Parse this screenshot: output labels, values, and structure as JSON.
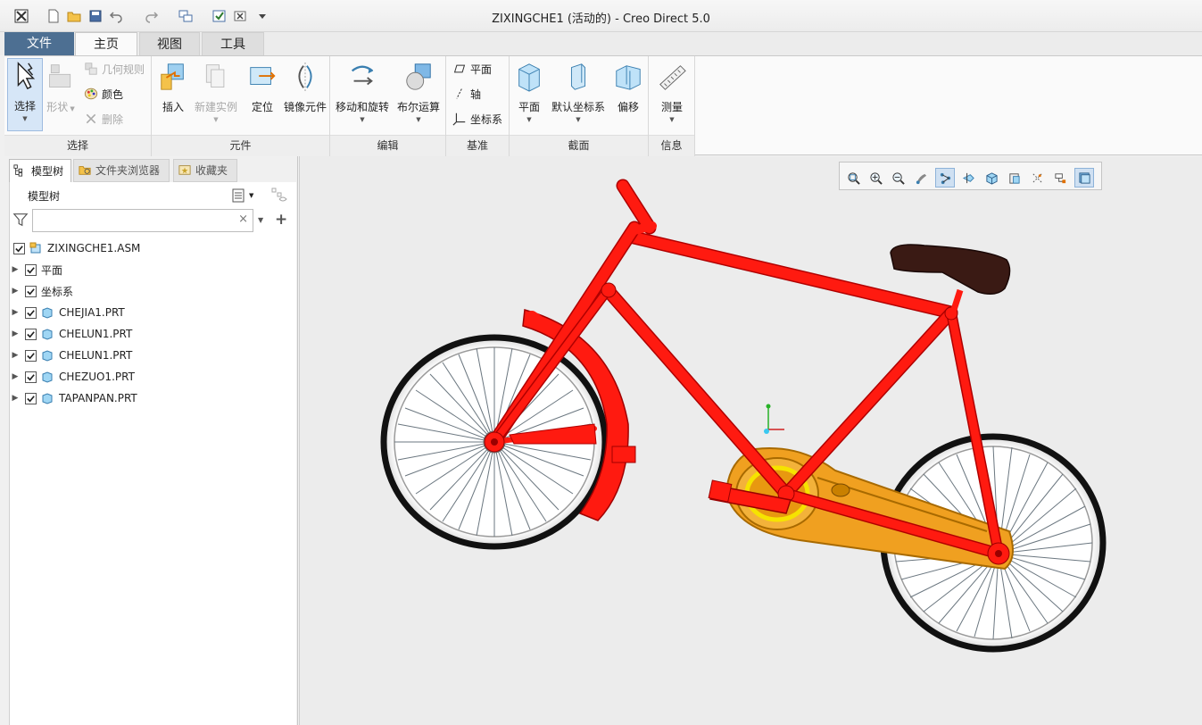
{
  "window": {
    "title": "ZIXINGCHE1 (活动的) - Creo Direct 5.0"
  },
  "ribbon_tabs": [
    {
      "label": "文件"
    },
    {
      "label": "主页"
    },
    {
      "label": "视图"
    },
    {
      "label": "工具"
    }
  ],
  "ribbon": {
    "select_group": {
      "label": "选择",
      "select_btn": "选择",
      "shape_btn": "形状",
      "geom_rules": "几何规则",
      "color": "颜色",
      "delete": "删除"
    },
    "component_group": {
      "label": "元件",
      "insert": "插入",
      "new_instance": "新建实例",
      "locate": "定位",
      "mirror": "镜像元件"
    },
    "edit_group": {
      "label": "编辑",
      "move_rotate": "移动和旋转",
      "boolean": "布尔运算"
    },
    "datum_group": {
      "label": "基准",
      "plane": "平面",
      "axis": "轴",
      "csys": "坐标系"
    },
    "section_group": {
      "label": "截面",
      "plane": "平面",
      "default_csys": "默认坐标系",
      "offset": "偏移"
    },
    "info_group": {
      "label": "信息",
      "measure": "测量"
    }
  },
  "panel_tabs": [
    {
      "label": "模型树"
    },
    {
      "label": "文件夹浏览器"
    },
    {
      "label": "收藏夹"
    }
  ],
  "model_tree": {
    "header": "模型树",
    "filter_value": "",
    "root": "ZIXINGCHE1.ASM",
    "items": [
      {
        "label": "平面",
        "icon": "folder"
      },
      {
        "label": "坐标系",
        "icon": "folder"
      },
      {
        "label": "CHEJIA1.PRT",
        "icon": "part"
      },
      {
        "label": "CHELUN1.PRT",
        "icon": "part"
      },
      {
        "label": "CHELUN1.PRT",
        "icon": "part"
      },
      {
        "label": "CHEZUO1.PRT",
        "icon": "part"
      },
      {
        "label": "TAPANPAN.PRT",
        "icon": "part"
      }
    ]
  },
  "colors": {
    "frame": "#ff1a10",
    "chainguard": "#f0a020",
    "tire": "#111111",
    "saddle": "#3a1a14",
    "file_tab": "#4d6f92"
  }
}
